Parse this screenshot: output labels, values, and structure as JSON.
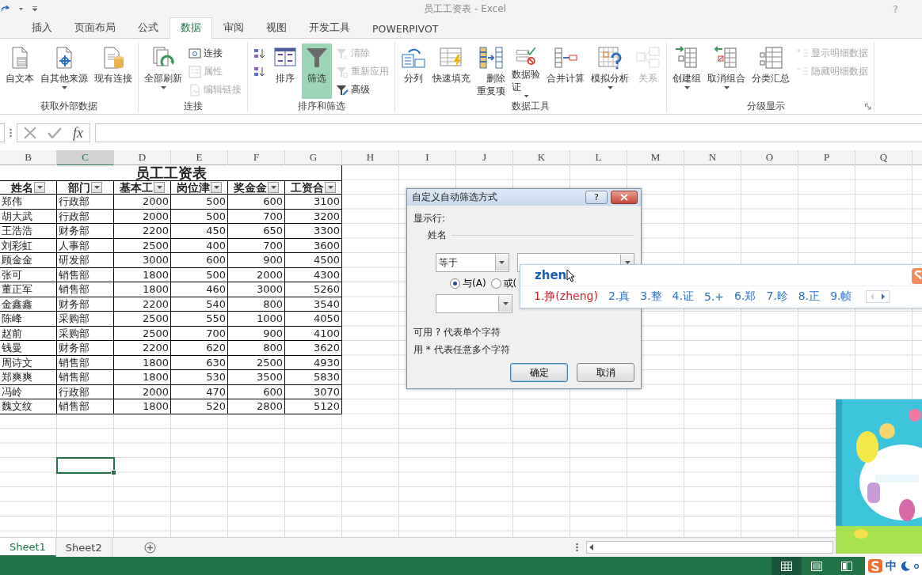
{
  "title_bar": {
    "title": "员工工资表 - Excel",
    "help": "?"
  },
  "ribbon_tabs": [
    {
      "label": "插入",
      "selected": false
    },
    {
      "label": "页面布局",
      "selected": false
    },
    {
      "label": "公式",
      "selected": false
    },
    {
      "label": "数据",
      "selected": true
    },
    {
      "label": "审阅",
      "selected": false
    },
    {
      "label": "视图",
      "selected": false
    },
    {
      "label": "开发工具",
      "selected": false
    },
    {
      "label": "POWERPIVOT",
      "selected": false
    }
  ],
  "ribbon_groups": [
    {
      "label": "获取外部数据",
      "items": [
        {
          "label": "自文本",
          "kind": "large",
          "disabled": false,
          "menu": false,
          "pressed": false
        },
        {
          "label": "自其他来源",
          "kind": "large",
          "disabled": false,
          "menu": true,
          "pressed": false
        },
        {
          "label": "现有连接",
          "kind": "large",
          "disabled": false,
          "menu": false,
          "pressed": false
        }
      ]
    },
    {
      "label": "连接",
      "items": [
        {
          "label": "全部刷新",
          "kind": "large",
          "disabled": false,
          "menu": true,
          "pressed": false
        },
        {
          "label": "连接",
          "kind": "small",
          "disabled": false,
          "menu": false,
          "pressed": false
        },
        {
          "label": "属性",
          "kind": "small",
          "disabled": true,
          "menu": false,
          "pressed": false
        },
        {
          "label": "编辑链接",
          "kind": "small",
          "disabled": true,
          "menu": false,
          "pressed": false
        }
      ]
    },
    {
      "label": "排序和筛选",
      "items": [
        {
          "kind": "icon",
          "disabled": false,
          "menu": false,
          "pressed": false
        },
        {
          "kind": "icon",
          "disabled": false,
          "menu": false,
          "pressed": false
        },
        {
          "label": "排序",
          "kind": "large",
          "disabled": false,
          "menu": false,
          "pressed": false
        },
        {
          "label": "筛选",
          "kind": "large",
          "disabled": false,
          "menu": false,
          "pressed": true
        },
        {
          "label": "清除",
          "kind": "small",
          "disabled": true,
          "menu": false,
          "pressed": false
        },
        {
          "label": "重新应用",
          "kind": "small",
          "disabled": true,
          "menu": false,
          "pressed": false
        },
        {
          "label": "高级",
          "kind": "small",
          "disabled": false,
          "menu": false,
          "pressed": false
        }
      ]
    },
    {
      "label": "数据工具",
      "items": [
        {
          "label": "分列",
          "kind": "large",
          "disabled": false,
          "menu": false,
          "pressed": false
        },
        {
          "label": "快速填充",
          "kind": "large",
          "disabled": false,
          "menu": false,
          "pressed": false
        },
        {
          "label": "删除重复项",
          "kind": "large-indent",
          "disabled": false,
          "menu": false,
          "pressed": false
        },
        {
          "label": "数据验证",
          "kind": "large-narrow",
          "disabled": false,
          "menu": true,
          "pressed": false
        },
        {
          "label": "合并计算",
          "kind": "large",
          "disabled": false,
          "menu": false,
          "pressed": false
        },
        {
          "label": "模拟分析",
          "kind": "large",
          "disabled": false,
          "menu": true,
          "pressed": false
        },
        {
          "label": "关系",
          "kind": "large",
          "disabled": true,
          "menu": false,
          "pressed": false
        }
      ]
    },
    {
      "label": "分级显示",
      "launcher": true,
      "items": [
        {
          "label": "创建组",
          "kind": "large",
          "disabled": false,
          "menu": true,
          "pressed": false
        },
        {
          "label": "取消组合",
          "kind": "large",
          "disabled": false,
          "menu": true,
          "pressed": false
        },
        {
          "label": "分类汇总",
          "kind": "large",
          "disabled": false,
          "menu": false,
          "pressed": false
        },
        {
          "label": "显示明细数据",
          "kind": "small",
          "disabled": true,
          "menu": false,
          "pressed": false
        },
        {
          "label": "隐藏明细数据",
          "kind": "small",
          "disabled": true,
          "menu": false,
          "pressed": false
        }
      ]
    }
  ],
  "formula_bar": {
    "function_label": "fx"
  },
  "column_headers": [
    {
      "label": "B",
      "selected": false
    },
    {
      "label": "C",
      "selected": true
    },
    {
      "label": "D",
      "selected": false
    },
    {
      "label": "E",
      "selected": false
    },
    {
      "label": "F",
      "selected": false
    },
    {
      "label": "G",
      "selected": false
    },
    {
      "label": "H",
      "selected": false
    },
    {
      "label": "I",
      "selected": false
    },
    {
      "label": "J",
      "selected": false
    },
    {
      "label": "K",
      "selected": false
    },
    {
      "label": "L",
      "selected": false
    },
    {
      "label": "M",
      "selected": false
    },
    {
      "label": "N",
      "selected": false
    },
    {
      "label": "O",
      "selected": false
    },
    {
      "label": "P",
      "selected": false
    },
    {
      "label": "Q",
      "selected": false
    }
  ],
  "table": {
    "title": "员工工资表",
    "columns": [
      "姓名",
      "部门",
      "基本工",
      "岗位津",
      "奖金金",
      "工资合"
    ],
    "rows": [
      [
        "郑伟",
        "行政部",
        "2000",
        "500",
        "600",
        "3100"
      ],
      [
        "胡大武",
        "行政部",
        "2000",
        "500",
        "700",
        "3200"
      ],
      [
        "王浩浩",
        "财务部",
        "2200",
        "450",
        "650",
        "3300"
      ],
      [
        "刘彩虹",
        "人事部",
        "2500",
        "400",
        "700",
        "3600"
      ],
      [
        "顾金金",
        "研发部",
        "3000",
        "600",
        "900",
        "4500"
      ],
      [
        "张可",
        "销售部",
        "1800",
        "500",
        "2000",
        "4300"
      ],
      [
        "董正军",
        "销售部",
        "1800",
        "460",
        "3000",
        "5260"
      ],
      [
        "金鑫鑫",
        "财务部",
        "2200",
        "540",
        "800",
        "3540"
      ],
      [
        "陈峰",
        "采购部",
        "2500",
        "550",
        "1000",
        "4050"
      ],
      [
        "赵前",
        "采购部",
        "2500",
        "700",
        "900",
        "4100"
      ],
      [
        "钱曼",
        "财务部",
        "2200",
        "620",
        "800",
        "3620"
      ],
      [
        "周诗文",
        "销售部",
        "1800",
        "630",
        "2500",
        "4930"
      ],
      [
        "郑爽爽",
        "销售部",
        "1800",
        "530",
        "3500",
        "5830"
      ],
      [
        "冯岭",
        "行政部",
        "2000",
        "470",
        "600",
        "3070"
      ],
      [
        "魏文纹",
        "销售部",
        "1800",
        "520",
        "2800",
        "5120"
      ]
    ]
  },
  "dialog": {
    "title": "自定义自动筛选方式",
    "help": "?",
    "show_rows_label": "显示行:",
    "field_label": "姓名",
    "condition_1": {
      "operator": "等于"
    },
    "logic": [
      {
        "label": "与(A)",
        "selected": true
      },
      {
        "label": "或(",
        "selected": false
      }
    ],
    "hints": [
      "可用 ? 代表单个字符",
      "用 * 代表任意多个字符"
    ],
    "buttons": [
      {
        "label": "确定",
        "kind": "default"
      },
      {
        "label": "取消",
        "kind": "normal"
      }
    ]
  },
  "ime": {
    "composition": "zhen",
    "candidates": [
      {
        "label": "1.挣(zheng)",
        "selected": true
      },
      {
        "label": "2.真",
        "selected": false
      },
      {
        "label": "3.整",
        "selected": false
      },
      {
        "label": "4.证",
        "selected": false
      },
      {
        "label": "5.+",
        "selected": false
      },
      {
        "label": "6.郑",
        "selected": false
      },
      {
        "label": "7.昣",
        "selected": false
      },
      {
        "label": "8.正",
        "selected": false
      },
      {
        "label": "9.帧",
        "selected": false
      }
    ]
  },
  "sheet_tabs": [
    {
      "label": "Sheet1",
      "selected": true
    },
    {
      "label": "Sheet2",
      "selected": false
    }
  ],
  "status_bar": {
    "views": [
      {
        "selected": true
      },
      {
        "selected": false
      },
      {
        "selected": false
      }
    ],
    "ime_mode": "中"
  }
}
